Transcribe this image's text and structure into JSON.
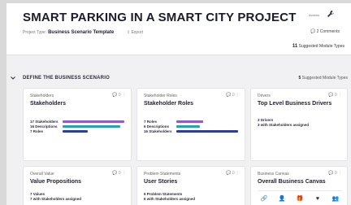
{
  "header": {
    "title": "SMART PARKING IN A SMART CITY PROJECT",
    "project_type_label": "Project Type:",
    "project_type_value": "Business Scenario Template",
    "export_label": "Export",
    "access_label": "Access",
    "comments_label": "2 Comments",
    "suggested_count": "11",
    "suggested_label": "Suggested Module Types"
  },
  "section": {
    "title": "DEFINE THE BUSINESS SCENARIO",
    "suggested_count": "5",
    "suggested_label": "Suggested Module Types"
  },
  "cards": [
    {
      "subtitle": "Stakeholders",
      "title": "Stakeholders",
      "meta": "0",
      "stats": [
        {
          "label": "17 Stakeholders",
          "fraction": 1.0,
          "color": "#8e5cc4"
        },
        {
          "label": "16 Descriptions",
          "fraction": 0.94,
          "color": "#2a9fb0"
        },
        {
          "label": "7 Roles",
          "fraction": 0.41,
          "color": "#2e3f9a"
        }
      ]
    },
    {
      "subtitle": "Stakeholder Roles",
      "title": "Stakeholder Roles",
      "meta": "0",
      "stats": [
        {
          "label": "7 Roles",
          "fraction": 0.44,
          "color": "#8e5cc4"
        },
        {
          "label": "6 Descriptions",
          "fraction": 0.38,
          "color": "#2a9fb0"
        },
        {
          "label": "16 Stakeholders",
          "fraction": 1.0,
          "color": "#2e3f9a"
        }
      ]
    },
    {
      "subtitle": "Drivers",
      "title": "Top Level Business Drivers",
      "meta": "0",
      "lines": [
        "3 Drivers",
        "3 with Stakeholders assigned"
      ]
    },
    {
      "subtitle": "Overall Value",
      "title": "Value Propositions",
      "meta": "0",
      "lines": [
        "7 Values",
        "7 with Stakeholders assigned"
      ]
    },
    {
      "subtitle": "Problem Statements",
      "title": "User Stories",
      "meta": "0",
      "lines": [
        "6 Problem Statements",
        "6 with Stakeholders assigned"
      ]
    },
    {
      "subtitle": "Business Canvas",
      "title": "Overall Business Canvas",
      "meta": "0",
      "icons": [
        "link-icon",
        "person-icon",
        "gift-icon",
        "heart-icon",
        "people-icon"
      ]
    }
  ]
}
